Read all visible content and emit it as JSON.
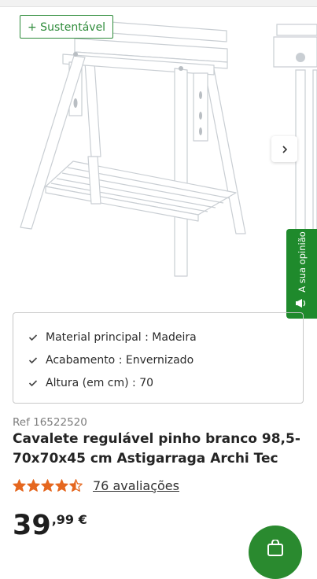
{
  "gallery": {
    "badge_label": "+ Sustentável",
    "next_arrow_icon": "chevron-right-icon"
  },
  "feedback_tab": {
    "label": "A sua opinião",
    "icon": "megaphone-icon"
  },
  "specs": [
    {
      "label": "Material principal",
      "value": "Madeira",
      "text": "Material principal : Madeira"
    },
    {
      "label": "Acabamento",
      "value": "Envernizado",
      "text": "Acabamento : Envernizado"
    },
    {
      "label": "Altura (em cm)",
      "value": "70",
      "text": "Altura (em cm) : 70"
    }
  ],
  "product": {
    "ref": "Ref 16522520",
    "title": "Cavalete regulável pinho branco 98,5-70x70x45 cm Astigarraga Archi Tec",
    "rating_value": 4.5,
    "rating_max": 5,
    "reviews_label": "76 avaliações",
    "price_integer": "39",
    "price_decimals": ",99 €"
  },
  "colors": {
    "brand_green": "#2e8b3a",
    "feedback_green": "#1f8a2c",
    "star_orange": "#e5671f"
  }
}
